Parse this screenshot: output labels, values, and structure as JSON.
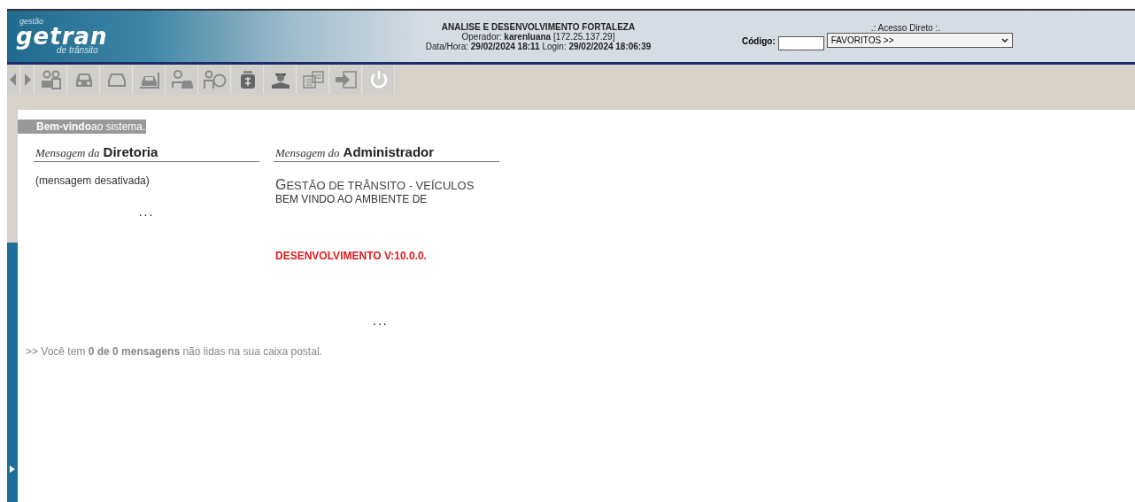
{
  "header": {
    "logo": {
      "top": "gestão",
      "main": "getran",
      "bottom": "de trânsito"
    },
    "title": "ANALISE E DESENVOLVIMENTO FORTALEZA",
    "operator_label": "Operador:",
    "operator": "karenluana",
    "ip": "[172.25.137.29]",
    "datetime_label": "Data/Hora:",
    "datetime": "29/02/2024 18:11",
    "login_label": "Login:",
    "login": "29/02/2024 18:06:39",
    "direct_access": ".: Acesso Direto :.",
    "code_label": "Código:",
    "favorites": "FAVORITOS >>"
  },
  "toolbar": [
    {
      "kind": "back"
    },
    {
      "kind": "forward"
    },
    {
      "kind": "people-desk"
    },
    {
      "kind": "car"
    },
    {
      "kind": "car-outline"
    },
    {
      "kind": "car-lift"
    },
    {
      "kind": "people-car"
    },
    {
      "kind": "person-speed"
    },
    {
      "kind": "money"
    },
    {
      "kind": "officer"
    },
    {
      "kind": "documents"
    },
    {
      "kind": "transfer"
    },
    {
      "kind": "power"
    }
  ],
  "welcome": "**Bem-vindo**ao sistema.",
  "board_panel": {
    "heading_prefix": "Mensagem da",
    "heading": "Diretoria",
    "message": "(mensagem desativada)",
    "more": "..."
  },
  "admin_panel": {
    "heading_prefix": "Mensagem do",
    "heading": "Administrador",
    "title": "GESTÃO DE TRÂNSITO - VEÍCULOS",
    "subtitle": "BEM VINDO AO AMBIENTE DE",
    "version": "DESENVOLVIMENTO V:10.0.0.",
    "more": "..."
  },
  "mail_notice": ">> Você tem **0 de 0 mensagens** não lidas na sua caixa postal."
}
